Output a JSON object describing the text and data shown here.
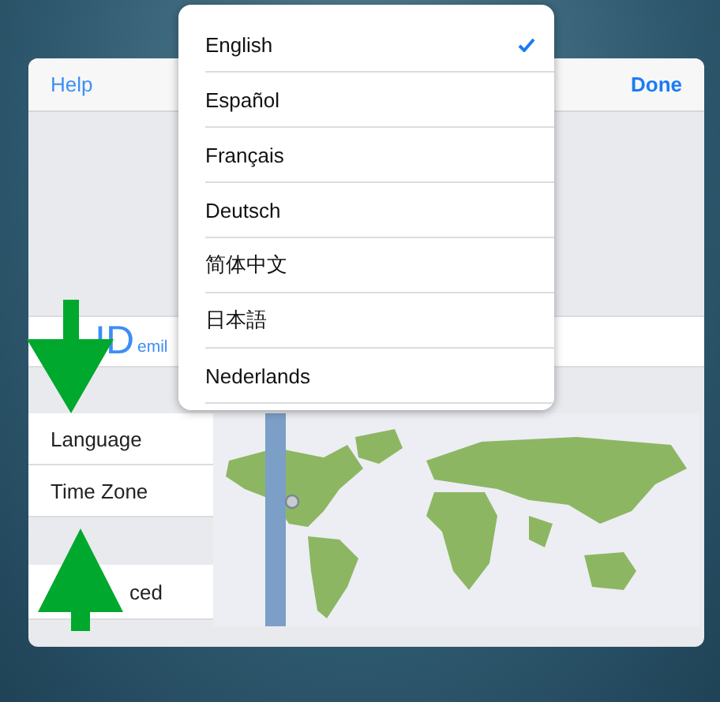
{
  "header": {
    "left_button": "Help",
    "right_button": "Done"
  },
  "account": {
    "icon_text": "ID",
    "label": "emil"
  },
  "settings": [
    {
      "label": "Language"
    },
    {
      "label": "Time Zone"
    }
  ],
  "advanced": {
    "label": "ced"
  },
  "language_menu": [
    {
      "label": "English",
      "selected": true
    },
    {
      "label": "Español",
      "selected": false
    },
    {
      "label": "Français",
      "selected": false
    },
    {
      "label": "Deutsch",
      "selected": false
    },
    {
      "label": "简体中文",
      "selected": false
    },
    {
      "label": "日本語",
      "selected": false
    },
    {
      "label": "Nederlands",
      "selected": false
    }
  ],
  "annotations": [
    {
      "kind": "arrow-down"
    },
    {
      "kind": "arrow-up"
    }
  ]
}
